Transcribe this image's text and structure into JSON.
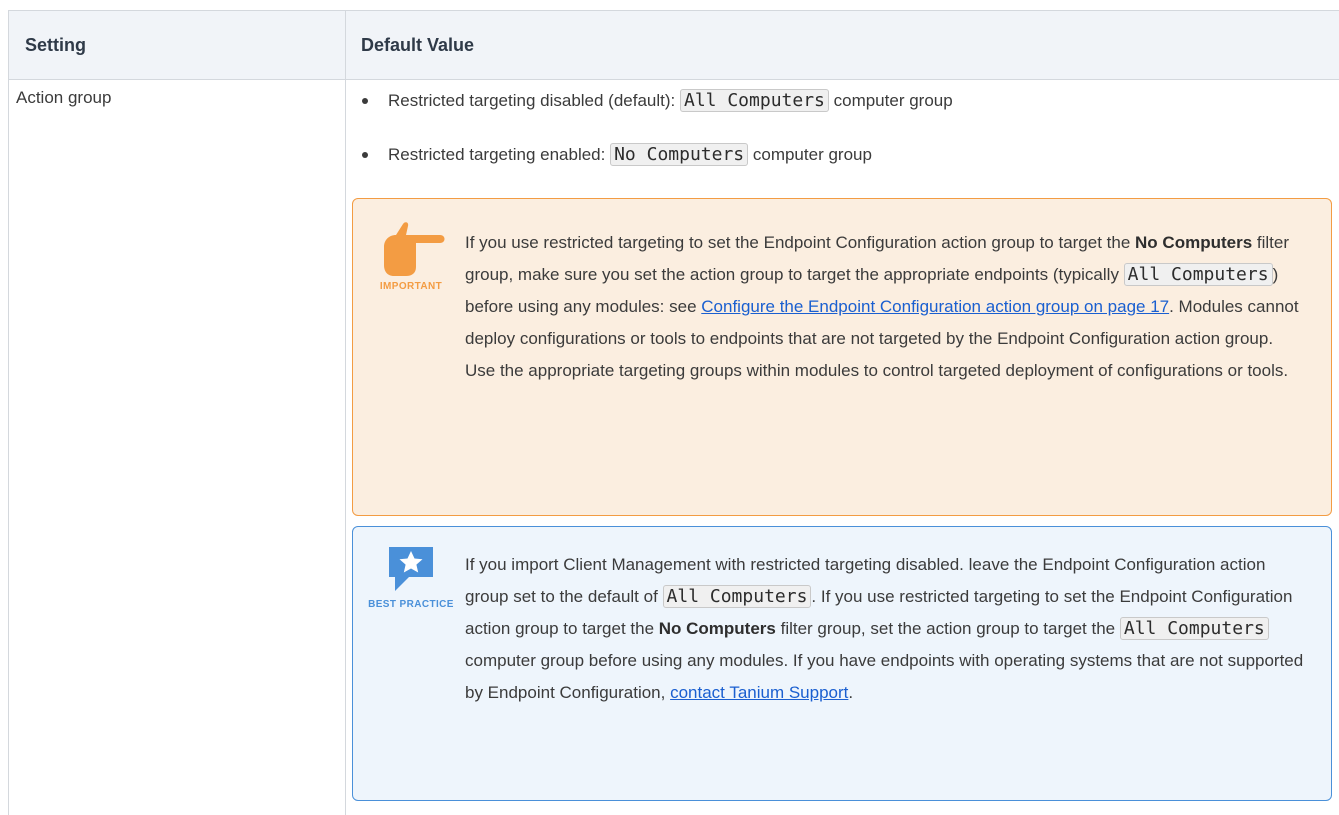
{
  "table": {
    "headers": {
      "setting": "Setting",
      "default_value": "Default Value"
    },
    "rows": [
      {
        "setting": "Action group",
        "bullets": [
          {
            "prefix": "Restricted targeting disabled (default): ",
            "code": "All Computers",
            "suffix": " computer group"
          },
          {
            "prefix": "Restricted targeting enabled: ",
            "code": "No Computers",
            "suffix": " computer group"
          }
        ]
      }
    ]
  },
  "notes": {
    "important": {
      "tag": "IMPORTANT",
      "t1": "If you use restricted targeting to set the Endpoint Configuration action group to target the ",
      "b1": "No Computers",
      "t2": " filter group, make sure you set the action group to target the appropriate endpoints (typically ",
      "code1": "All Computers",
      "t3": ") before using any modules: see ",
      "link1": "Configure the Endpoint Configuration action group on page 17",
      "t4": ". Modules cannot deploy configurations or tools to endpoints that are not targeted by the Endpoint Configuration action group. Use the appropriate targeting groups within modules to control targeted deployment of configurations or tools."
    },
    "best_practice": {
      "tag": "BEST PRACTICE",
      "t1": "If you import Client Management with restricted targeting disabled. leave the Endpoint Configuration action group set to the default of ",
      "code1": "All Computers",
      "t2": ".  If you use restricted targeting to set the Endpoint Configuration action group to target the ",
      "b1": "No Computers",
      "t3": " filter group, set the action group to target the ",
      "code2": "All Computers",
      "t4": " computer group before using any modules. If you have endpoints with operating systems that are not supported by Endpoint Configuration, ",
      "link1": "contact Tanium Support",
      "t5": "."
    }
  },
  "colors": {
    "header_bg": "#f1f4f8",
    "important_bg": "#fbeee0",
    "important_accent": "#f39c43",
    "best_bg": "#eef5fc",
    "best_accent": "#4a90d9",
    "link": "#1a5fd0"
  },
  "icons": {
    "important": "pointing-hand-icon",
    "best_practice": "star-badge-icon"
  }
}
